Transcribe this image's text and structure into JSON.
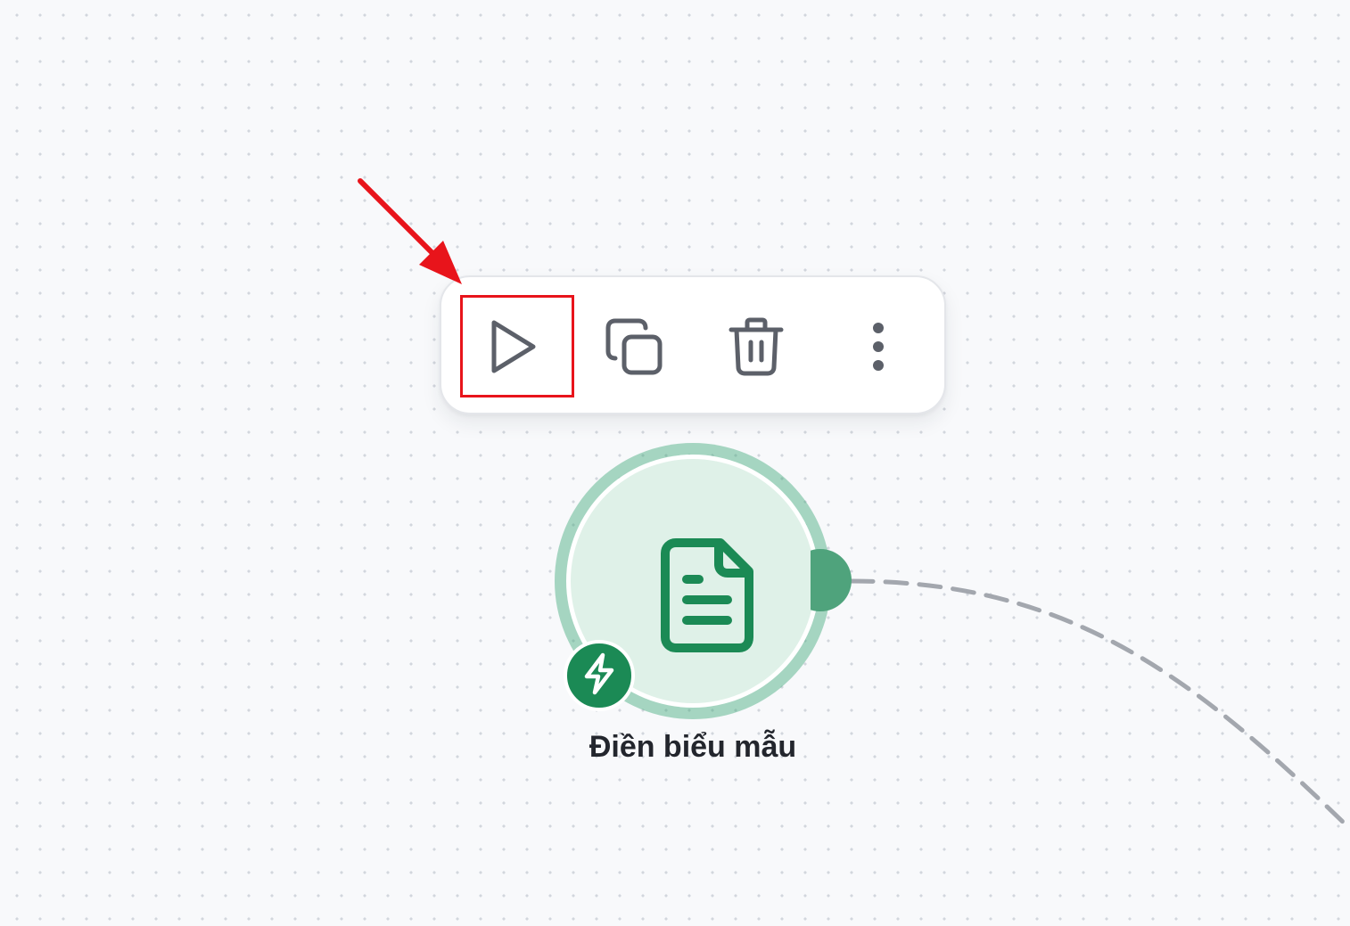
{
  "canvas": {
    "background": "#f8f9fb",
    "dot_color": "#d2d6dd",
    "edge_color": "#a3a7ae"
  },
  "node_toolbar": {
    "actions": [
      {
        "id": "run",
        "icon": "play-icon",
        "tooltip": ""
      },
      {
        "id": "duplicate",
        "icon": "copy-icon",
        "tooltip": ""
      },
      {
        "id": "delete",
        "icon": "trash-icon",
        "tooltip": ""
      },
      {
        "id": "more",
        "icon": "more-vertical-icon",
        "tooltip": ""
      }
    ],
    "icon_color": "#5c6069"
  },
  "node": {
    "label": "Điền biểu mẫu",
    "icon": "document-icon",
    "badge_icon": "lightning-icon",
    "accent_color": "#1b8a55",
    "fill_color": "#dff1e8"
  },
  "annotation": {
    "highlight_color": "#e8141b",
    "target": "run"
  }
}
